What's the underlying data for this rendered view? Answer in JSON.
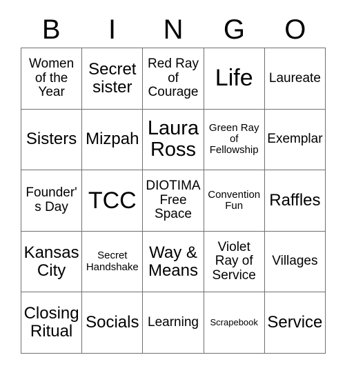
{
  "header": {
    "letters": [
      "B",
      "I",
      "N",
      "G",
      "O"
    ]
  },
  "grid": {
    "rows": [
      [
        {
          "text": "Women of the Year",
          "size": "sm"
        },
        {
          "text": "Secret sister",
          "size": "md"
        },
        {
          "text": "Red Ray of Courage",
          "size": "sm"
        },
        {
          "text": "Life",
          "size": "xl"
        },
        {
          "text": "Laureate",
          "size": "sm"
        }
      ],
      [
        {
          "text": "Sisters",
          "size": "md"
        },
        {
          "text": "Mizpah",
          "size": "md"
        },
        {
          "text": "Laura Ross",
          "size": "lg"
        },
        {
          "text": "Green Ray of Fellowship",
          "size": "xs"
        },
        {
          "text": "Exemplar",
          "size": "sm"
        }
      ],
      [
        {
          "text": "Founder's Day",
          "size": "sm"
        },
        {
          "text": "TCC",
          "size": "xl"
        },
        {
          "text": "DIOTIMA Free Space",
          "size": "sm"
        },
        {
          "text": "Convention Fun",
          "size": "xs"
        },
        {
          "text": "Raffles",
          "size": "md"
        }
      ],
      [
        {
          "text": "Kansas City",
          "size": "md"
        },
        {
          "text": "Secret Handshake",
          "size": "xs"
        },
        {
          "text": "Way & Means",
          "size": "md"
        },
        {
          "text": "Violet Ray of Service",
          "size": "sm"
        },
        {
          "text": "Villages",
          "size": "sm"
        }
      ],
      [
        {
          "text": "Closing Ritual",
          "size": "md"
        },
        {
          "text": "Socials",
          "size": "md"
        },
        {
          "text": "Learning",
          "size": "sm"
        },
        {
          "text": "Scrapebook",
          "size": "xxs"
        },
        {
          "text": "Service",
          "size": "md"
        }
      ]
    ]
  },
  "colors": {
    "background": "#ffffff",
    "text": "#000000",
    "grid_line": "#6f6f6f"
  }
}
